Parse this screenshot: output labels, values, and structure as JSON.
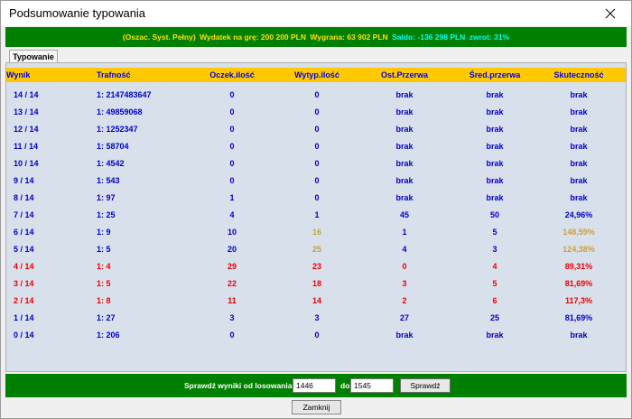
{
  "window": {
    "title": "Podsumowanie typowania",
    "close_icon": "close-icon"
  },
  "info": {
    "system": "(Oszac. Syst. Pełny)",
    "wydatek": "Wydatek na grę: 200 200 PLN",
    "wygrana": "Wygrana: 63 902 PLN",
    "saldo": "Saldo: -136 298 PLN",
    "zwrot": "zwrot: 31%"
  },
  "tabs": [
    {
      "label": "Typowanie",
      "selected": true
    }
  ],
  "table": {
    "headers": [
      "Wynik",
      "Trafność",
      "Oczek.ilość",
      "Wytyp.ilość",
      "Ost.Przerwa",
      "Śred.przerwa",
      "Skuteczność"
    ],
    "rows": [
      {
        "wynik": "14 / 14",
        "trafnosc": "1: 2147483647",
        "oczek": "0",
        "wytyp": "0",
        "ost": "brak",
        "sred": "brak",
        "skut": "brak",
        "color": "#0000cc",
        "skut_color": "#0000cc"
      },
      {
        "wynik": "13 / 14",
        "trafnosc": "1: 49859068",
        "oczek": "0",
        "wytyp": "0",
        "ost": "brak",
        "sred": "brak",
        "skut": "brak",
        "color": "#0000cc",
        "skut_color": "#0000cc"
      },
      {
        "wynik": "12 / 14",
        "trafnosc": "1: 1252347",
        "oczek": "0",
        "wytyp": "0",
        "ost": "brak",
        "sred": "brak",
        "skut": "brak",
        "color": "#0000cc",
        "skut_color": "#0000cc"
      },
      {
        "wynik": "11 / 14",
        "trafnosc": "1: 58704",
        "oczek": "0",
        "wytyp": "0",
        "ost": "brak",
        "sred": "brak",
        "skut": "brak",
        "color": "#0000cc",
        "skut_color": "#0000cc"
      },
      {
        "wynik": "10 / 14",
        "trafnosc": "1: 4542",
        "oczek": "0",
        "wytyp": "0",
        "ost": "brak",
        "sred": "brak",
        "skut": "brak",
        "color": "#0000cc",
        "skut_color": "#0000cc"
      },
      {
        "wynik": "9 / 14",
        "trafnosc": "1: 543",
        "oczek": "0",
        "wytyp": "0",
        "ost": "brak",
        "sred": "brak",
        "skut": "brak",
        "color": "#0000cc",
        "skut_color": "#0000cc"
      },
      {
        "wynik": "8 / 14",
        "trafnosc": "1: 97",
        "oczek": "1",
        "wytyp": "0",
        "ost": "brak",
        "sred": "brak",
        "skut": "brak",
        "color": "#0000cc",
        "skut_color": "#0000cc"
      },
      {
        "wynik": "7 / 14",
        "trafnosc": "1: 25",
        "oczek": "4",
        "wytyp": "1",
        "ost": "45",
        "sred": "50",
        "skut": "24,96%",
        "color": "#0000cc",
        "skut_color": "#0000cc"
      },
      {
        "wynik": "6 / 14",
        "trafnosc": "1: 9",
        "oczek": "10",
        "wytyp": "16",
        "ost": "1",
        "sred": "5",
        "skut": "148,59%",
        "color": "#0000cc",
        "wytyp_color": "#c8a040",
        "skut_color": "#c8a040"
      },
      {
        "wynik": "5 / 14",
        "trafnosc": "1: 5",
        "oczek": "20",
        "wytyp": "25",
        "ost": "4",
        "sred": "3",
        "skut": "124,38%",
        "color": "#0000cc",
        "wytyp_color": "#c8a040",
        "skut_color": "#c8a040"
      },
      {
        "wynik": "4 / 14",
        "trafnosc": "1: 4",
        "oczek": "29",
        "wytyp": "23",
        "ost": "0",
        "sred": "4",
        "skut": "89,31%",
        "color": "#ee0000",
        "skut_color": "#ee0000"
      },
      {
        "wynik": "3 / 14",
        "trafnosc": "1: 5",
        "oczek": "22",
        "wytyp": "18",
        "ost": "3",
        "sred": "5",
        "skut": "81,69%",
        "color": "#ee0000",
        "skut_color": "#ee0000"
      },
      {
        "wynik": "2 / 14",
        "trafnosc": "1: 8",
        "oczek": "11",
        "wytyp": "14",
        "ost": "2",
        "sred": "6",
        "skut": "117,3%",
        "color": "#ee0000",
        "skut_color": "#ee0000"
      },
      {
        "wynik": "1 / 14",
        "trafnosc": "1: 27",
        "oczek": "3",
        "wytyp": "3",
        "ost": "27",
        "sred": "25",
        "skut": "81,69%",
        "color": "#0000cc",
        "skut_color": "#0000cc"
      },
      {
        "wynik": "0 / 14",
        "trafnosc": "1: 206",
        "oczek": "0",
        "wytyp": "0",
        "ost": "brak",
        "sred": "brak",
        "skut": "brak",
        "color": "#0000cc",
        "skut_color": "#0000cc"
      }
    ]
  },
  "bottom": {
    "label": "Sprawdź wyniki od losowania:",
    "from_value": "1446",
    "to_label": "do",
    "to_value": "1545",
    "check_button": "Sprawdź"
  },
  "close_button": "Zamknij",
  "colors": {
    "green_bar": "#008000",
    "header_bg": "#ffc800",
    "panel_bg": "#d8e0ec"
  }
}
